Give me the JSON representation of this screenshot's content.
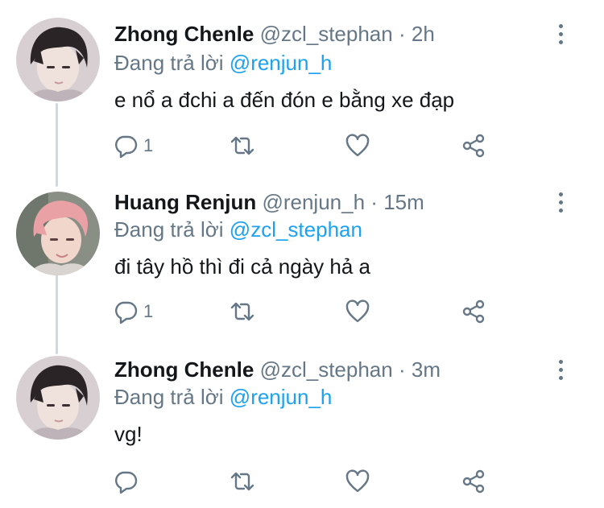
{
  "tweets": [
    {
      "display_name": "Zhong Chenle",
      "handle": "@zcl_stephan",
      "separator": "·",
      "timestamp": "2h",
      "reply_prefix": "Đang trả lời",
      "reply_to": "@renjun_h",
      "text": "e nổ a đchi a đến đón e bằng xe đạp",
      "reply_count": "1",
      "avatar_icon": "user-avatar"
    },
    {
      "display_name": "Huang Renjun",
      "handle": "@renjun_h",
      "separator": "·",
      "timestamp": "15m",
      "reply_prefix": "Đang trả lời",
      "reply_to": "@zcl_stephan",
      "text": "đi tây hồ thì đi cả ngày hả a",
      "reply_count": "1",
      "avatar_icon": "user-avatar"
    },
    {
      "display_name": "Zhong Chenle",
      "handle": "@zcl_stephan",
      "separator": "·",
      "timestamp": "3m",
      "reply_prefix": "Đang trả lời",
      "reply_to": "@renjun_h",
      "text": "vg!",
      "reply_count": "",
      "avatar_icon": "user-avatar"
    }
  ],
  "icons": {
    "reply": "reply-icon",
    "retweet": "retweet-icon",
    "like": "heart-icon",
    "share": "share-icon",
    "more": "more-options-icon"
  },
  "colors": {
    "text_primary": "#14171a",
    "text_secondary": "#657786",
    "link": "#1da1f2",
    "thread_line": "#cfd9de"
  }
}
